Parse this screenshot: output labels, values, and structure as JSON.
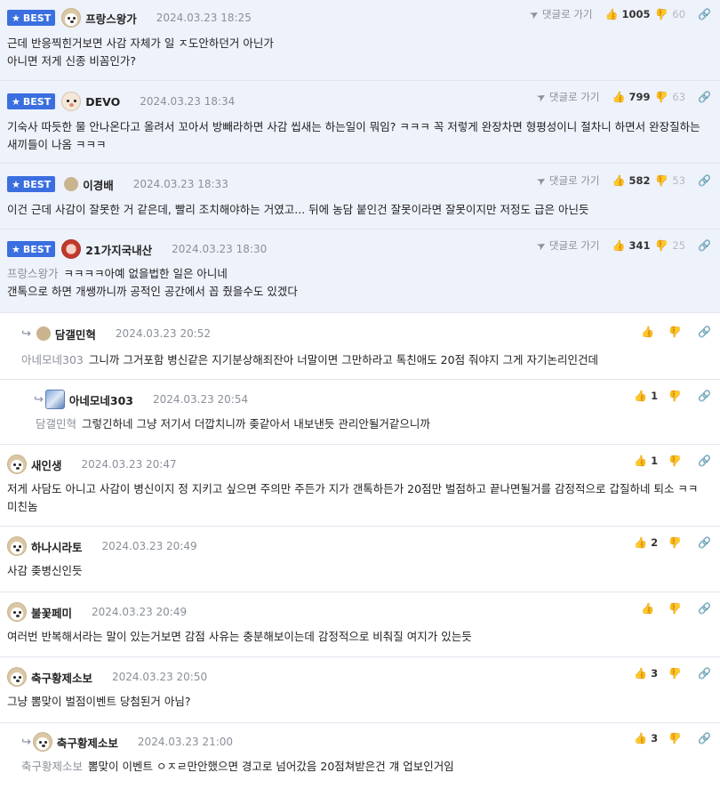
{
  "ui": {
    "best_label": "BEST",
    "reply_label": "댓글로 가기"
  },
  "comments": [
    {
      "nick": "프랑스왕가",
      "date": "2024.03.23 18:25",
      "best": true,
      "up": "1005",
      "down": "60",
      "mention": "",
      "text": "근데 반응찍힌거보면 사감 자체가 일 ㅈ도안하던거 아닌가\n아니면 저게 신종 비꼼인가?"
    },
    {
      "nick": "DEVO",
      "date": "2024.03.23 18:34",
      "best": true,
      "up": "799",
      "down": "63",
      "mention": "",
      "text": "기숙사 따듯한 물 안나온다고 올려서 꼬아서 방빼라하면 사감 씹새는 하는일이 뭐임? ㅋㅋㅋ 꼭 저렇게 완장차면 형평성이니 절차니 하면서 완장질하는 새끼들이 나옴 ㅋㅋㅋ"
    },
    {
      "nick": "이경배",
      "date": "2024.03.23 18:33",
      "best": true,
      "up": "582",
      "down": "53",
      "mention": "",
      "text": "이건 근데 사감이 잘못한 거 같은데, 빨리 조치해야하는 거였고... 뒤에 농담 붙인건 잘못이라면 잘못이지만 저정도 급은 아닌듯"
    },
    {
      "nick": "21가지국내산",
      "date": "2024.03.23 18:30",
      "best": true,
      "up": "341",
      "down": "25",
      "mention": "프랑스왕가",
      "text": "ㅋㅋㅋㅋ아예 없을법한 일은 아니네\n갠톡으로 하면 개쌩까니까 공적인 공간에서 꼽 줬을수도 있겠다"
    },
    {
      "nick": "담갤민혁",
      "date": "2024.03.23 20:52",
      "best": false,
      "up": "",
      "down": "",
      "mention": "아네모네303",
      "text": "그니까 그거포함 병신같은 지기분상해죄잔아 너말이면 그만하라고 톡친애도 20점 줘야지 그게 자기논리인건데"
    },
    {
      "nick": "아네모네303",
      "date": "2024.03.23 20:54",
      "best": false,
      "up": "1",
      "down": "",
      "mention": "담갤민혁",
      "text": "그렇긴하네 그냥 저기서 더깝치니까 좆같아서 내보낸듯 관리안될거같으니까"
    },
    {
      "nick": "새인생",
      "date": "2024.03.23 20:47",
      "best": false,
      "up": "1",
      "down": "",
      "mention": "",
      "text": "저게 사담도 아니고 사감이 병신이지 정 지키고 싶으면 주의만 주든가 지가 갠톡하든가 20점만 벌점하고 끝나면될거를 감정적으로 갑질하네 퇴소 ㅋㅋ 미친놈"
    },
    {
      "nick": "하나시라토",
      "date": "2024.03.23 20:49",
      "best": false,
      "up": "2",
      "down": "",
      "mention": "",
      "text": "사감 좆병신인듯"
    },
    {
      "nick": "불꽃페미",
      "date": "2024.03.23 20:49",
      "best": false,
      "up": "",
      "down": "",
      "mention": "",
      "text": "여러번 반복해서라는 말이 있는거보면 감점 사유는 충분해보이는데 감정적으로 비춰질 여지가 있는듯"
    },
    {
      "nick": "축구황제소보",
      "date": "2024.03.23 20:50",
      "best": false,
      "up": "3",
      "down": "",
      "mention": "",
      "text": "그냥 뽐맞이 벌점이벤트 당첨된거 아님?"
    },
    {
      "nick": "축구황제소보",
      "date": "2024.03.23 21:00",
      "best": false,
      "up": "3",
      "down": "",
      "mention": "축구황제소보",
      "text": "뽐맞이 이벤트 ㅇㅈㄹ만안했으면 경고로 넘어갔음 20점쳐받은건 걔 업보인거임"
    }
  ]
}
